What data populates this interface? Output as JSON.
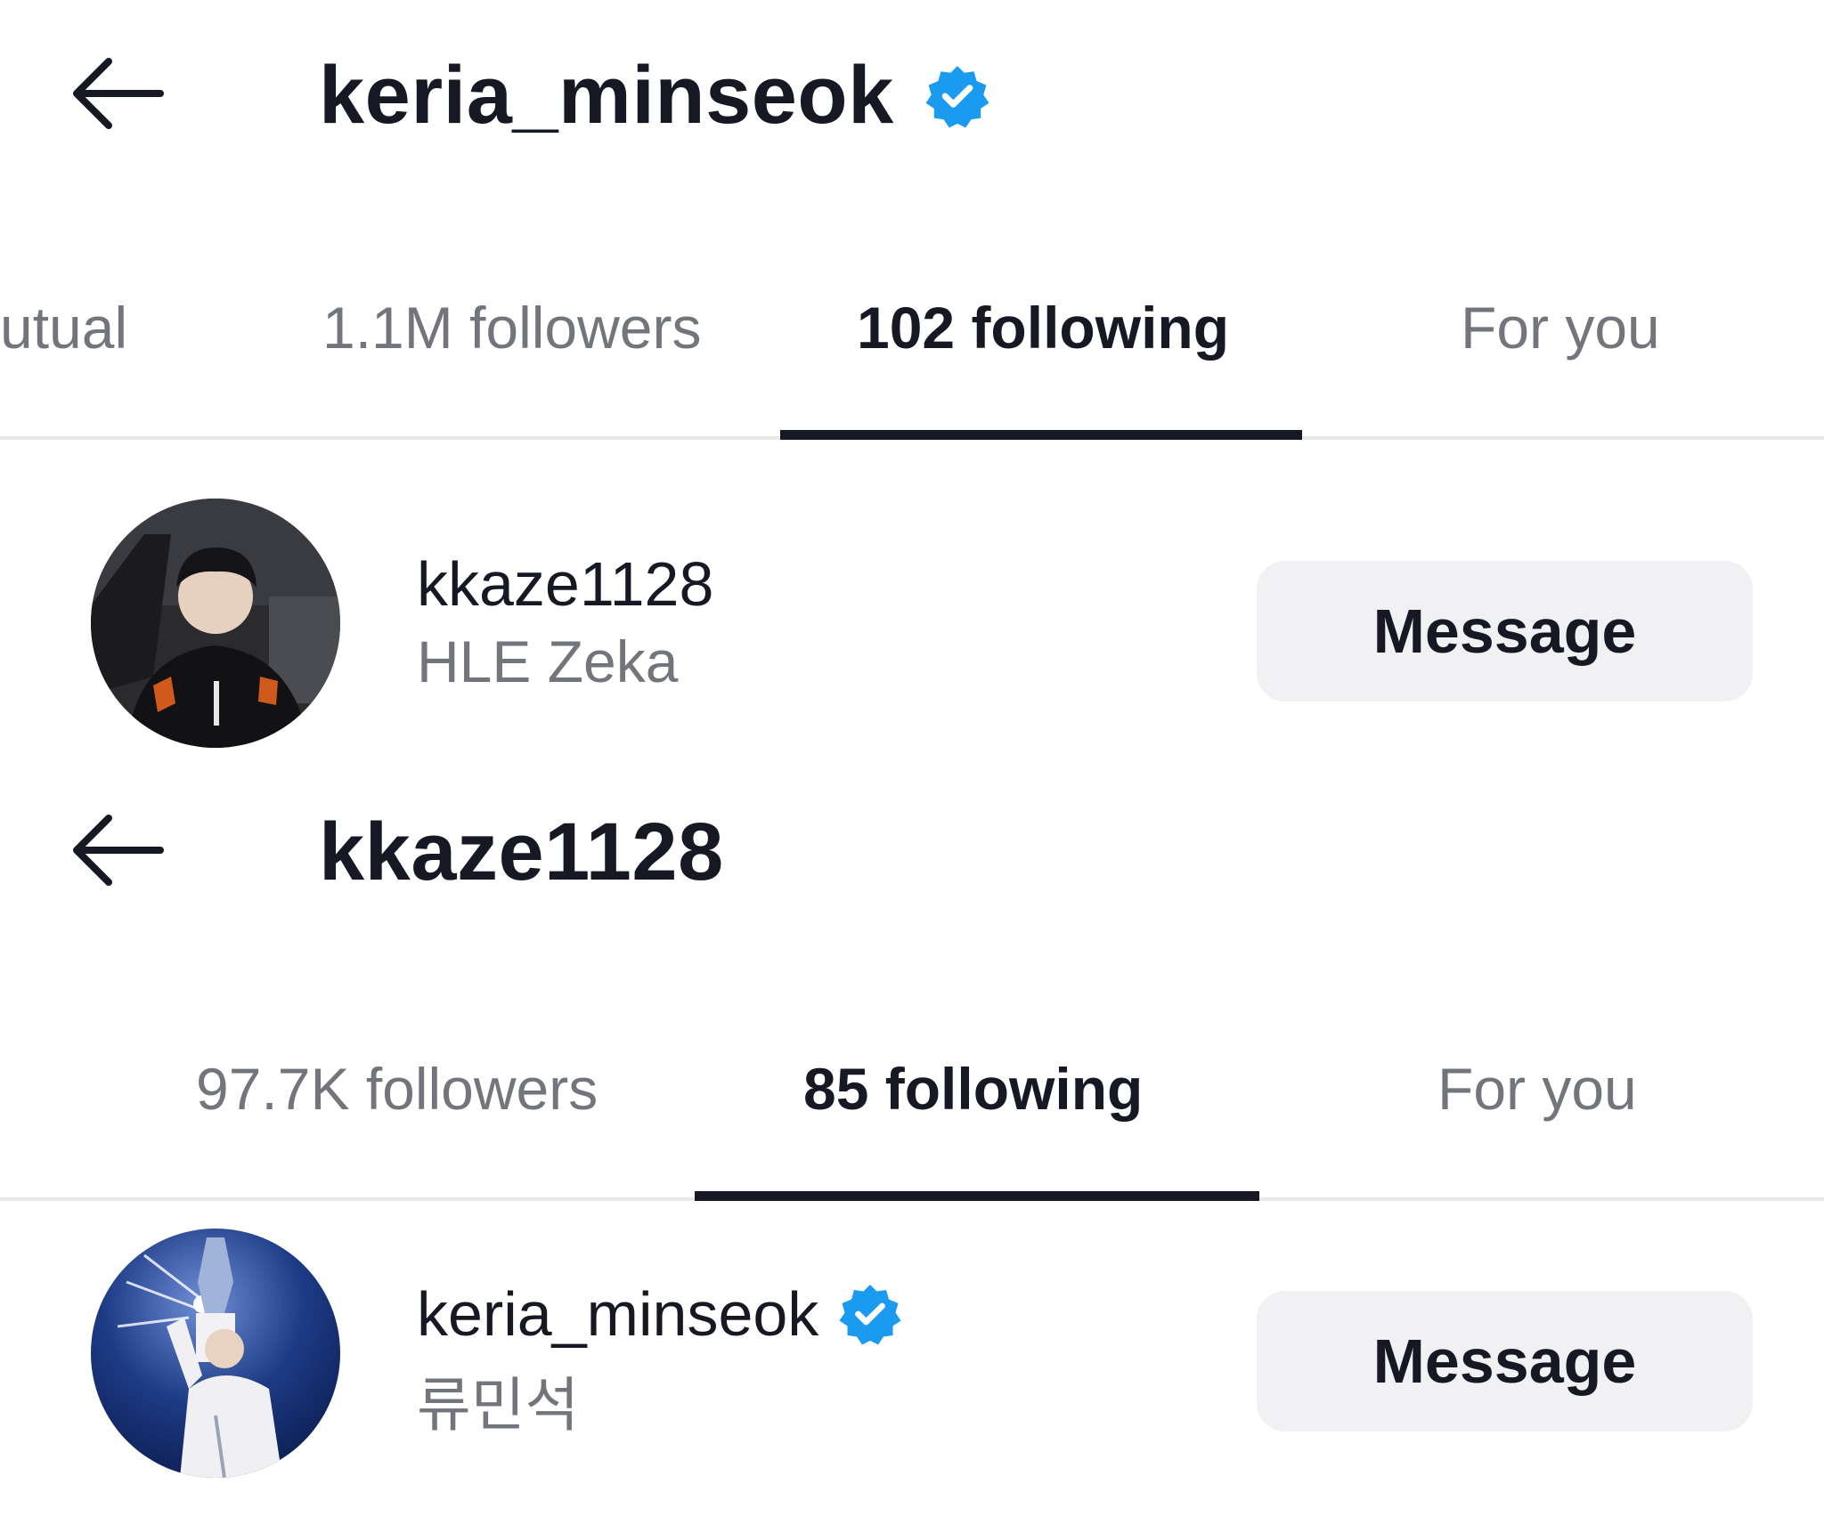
{
  "screen1": {
    "title": "keria_minseok",
    "title_verified": true,
    "tabs": [
      {
        "label": "utual",
        "active": false
      },
      {
        "label": "1.1M followers",
        "active": false
      },
      {
        "label": "102 following",
        "active": true
      },
      {
        "label": "For you",
        "active": false
      }
    ],
    "user": {
      "username": "kkaze1128",
      "display_name": "HLE Zeka",
      "verified": false,
      "button_label": "Message",
      "avatar_icon": "profile-photo-player-at-desk"
    }
  },
  "screen2": {
    "title": "kkaze1128",
    "title_verified": false,
    "tabs": [
      {
        "label": "97.7K followers",
        "active": false
      },
      {
        "label": "85 following",
        "active": true
      },
      {
        "label": "For you",
        "active": false
      }
    ],
    "user": {
      "username": "keria_minseok",
      "display_name": "류민석",
      "verified": true,
      "button_label": "Message",
      "avatar_icon": "profile-photo-trophy-lift"
    }
  },
  "icons": {
    "back": "arrow-left-icon",
    "verified": "verified-badge-icon"
  },
  "colors": {
    "text_primary": "#161823",
    "text_secondary": "#73757c",
    "verified_blue": "#20d5ec",
    "verified_badge": "#1a9bf0",
    "button_bg": "#f1f1f3",
    "divider": "#e7e8ea"
  }
}
